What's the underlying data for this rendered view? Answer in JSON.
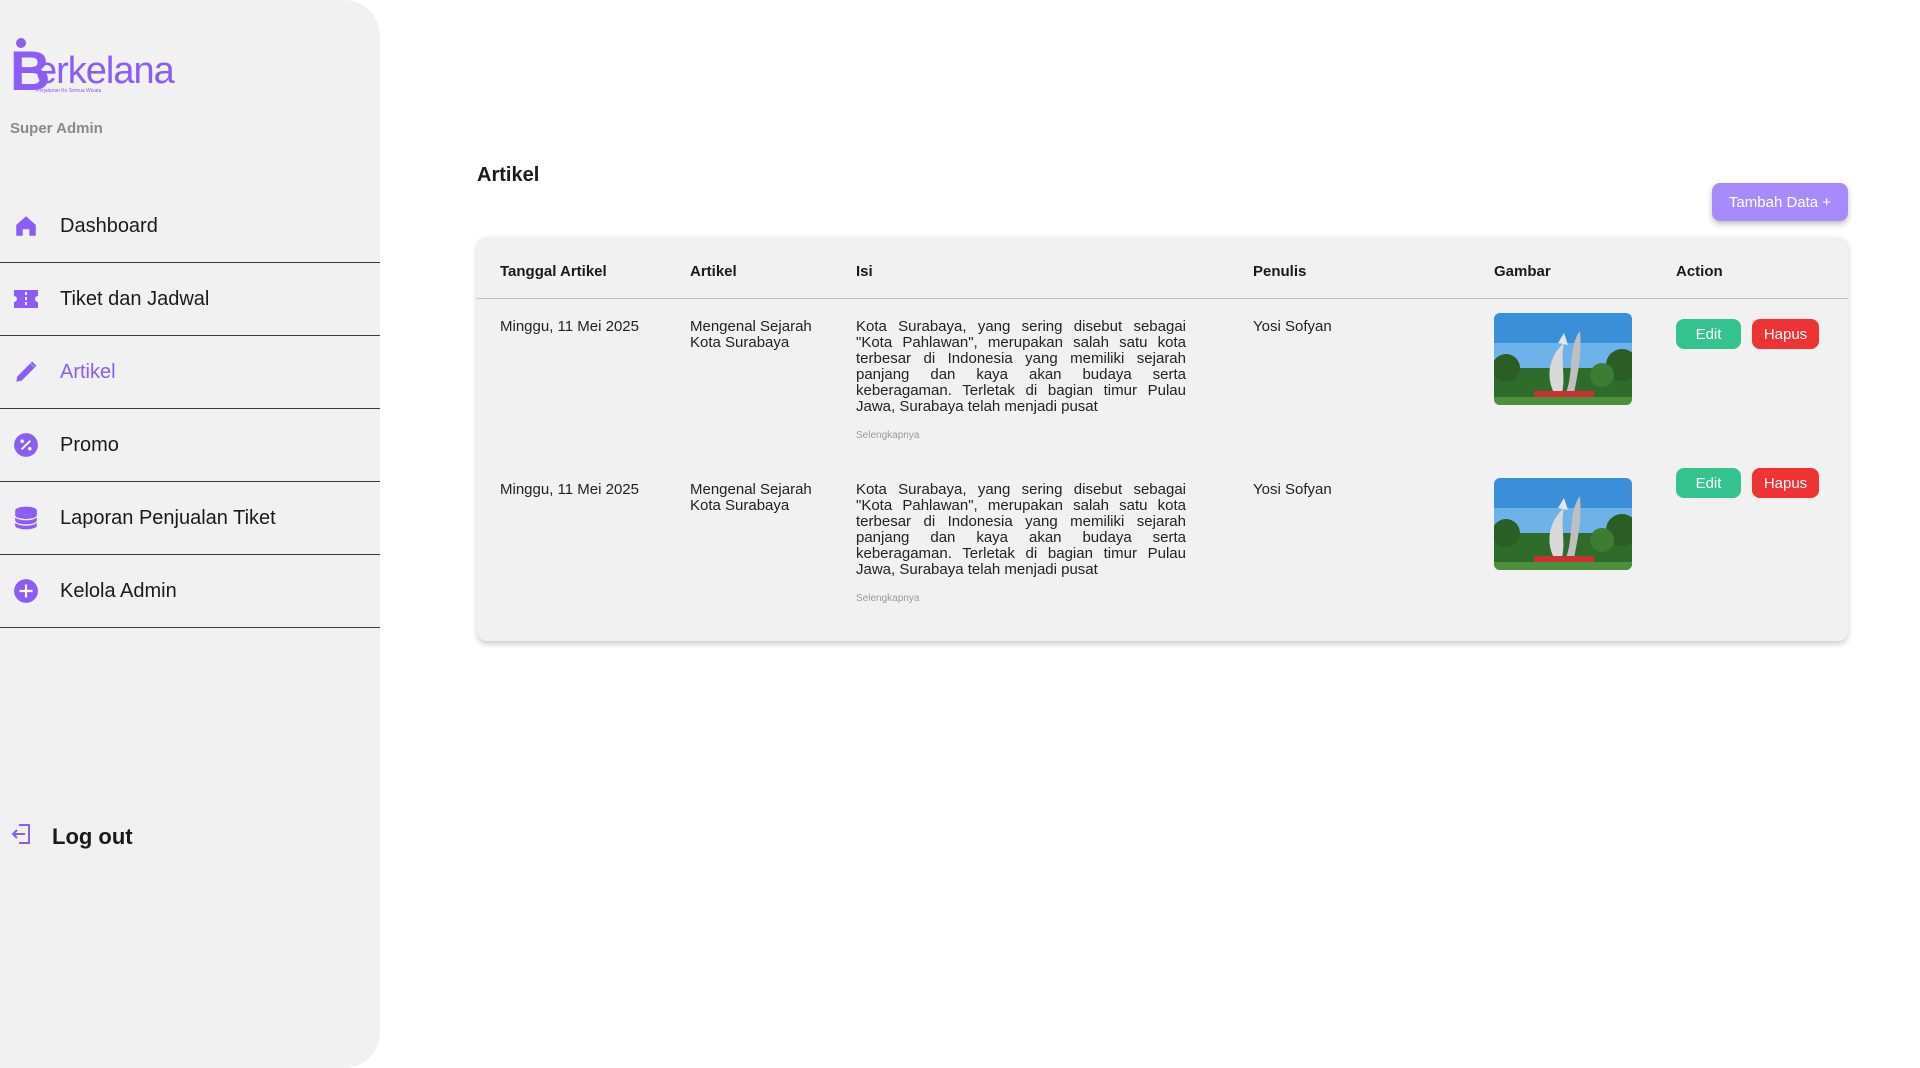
{
  "brand": {
    "name": "Berkelana",
    "name_rest": "erkelana",
    "letter": "B",
    "tagline": "Perjalanan Ke Semua Wisata",
    "role": "Super Admin"
  },
  "colors": {
    "accent": "#8b5cf6",
    "add_button": "#a78bfa",
    "edit_button": "#34c38f",
    "delete_button": "#ef3232",
    "sidebar_bg": "#f1f1f1"
  },
  "sidebar": {
    "items": [
      {
        "label": "Dashboard",
        "icon": "home-icon",
        "active": false
      },
      {
        "label": "Tiket dan Jadwal",
        "icon": "ticket-icon",
        "active": false
      },
      {
        "label": "Artikel",
        "icon": "pencil-icon",
        "active": true
      },
      {
        "label": "Promo",
        "icon": "percent-badge-icon",
        "active": false
      },
      {
        "label": "Laporan Penjualan Tiket",
        "icon": "database-icon",
        "active": false
      },
      {
        "label": "Kelola Admin",
        "icon": "plus-circle-icon",
        "active": false
      }
    ],
    "logout": {
      "label": "Log out",
      "icon": "logout-icon"
    }
  },
  "main": {
    "title": "Artikel",
    "add_button": "Tambah Data +",
    "table": {
      "headers": [
        "Tanggal Artikel",
        "Artikel",
        "Isi",
        "Penulis",
        "Gambar",
        "Action"
      ],
      "rows": [
        {
          "tanggal": "Minggu, 11 Mei 2025",
          "artikel": "Mengenal Sejarah Kota Surabaya",
          "isi": "Kota Surabaya, yang sering disebut sebagai \"Kota Pahlawan\", merupakan salah satu kota terbesar di Indonesia yang memiliki sejarah panjang dan kaya akan budaya serta keberagaman. Terletak di bagian timur Pulau Jawa, Surabaya telah menjadi pusat",
          "more": "Selengkapnya",
          "penulis": "Yosi Sofyan",
          "gambar": "surabaya-monument-photo",
          "edit": "Edit",
          "hapus": "Hapus"
        },
        {
          "tanggal": "Minggu, 11 Mei 2025",
          "artikel": "Mengenal Sejarah Kota Surabaya",
          "isi": "Kota Surabaya, yang sering disebut sebagai \"Kota Pahlawan\", merupakan salah satu kota terbesar di Indonesia yang memiliki sejarah panjang dan kaya akan budaya serta keberagaman. Terletak di bagian timur Pulau Jawa, Surabaya telah menjadi pusat",
          "more": "Selengkapnya",
          "penulis": "Yosi Sofyan",
          "gambar": "surabaya-monument-photo",
          "edit": "Edit",
          "hapus": "Hapus"
        }
      ]
    }
  }
}
